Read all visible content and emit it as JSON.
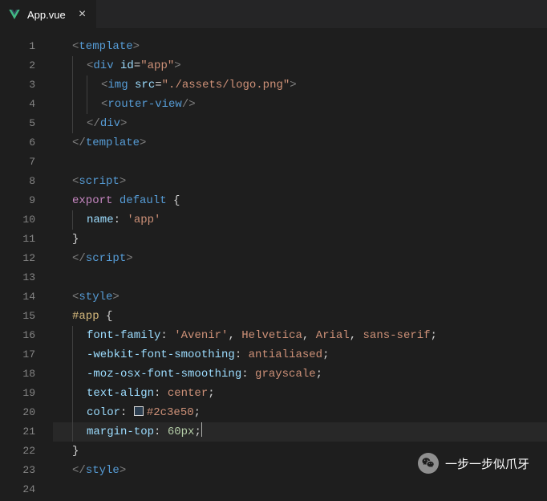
{
  "tab": {
    "filename": "App.vue",
    "close_glyph": "×"
  },
  "gutter": {
    "start": 1,
    "end": 24
  },
  "code": {
    "l1": {
      "p1": "<",
      "tag": "template",
      "p2": ">"
    },
    "l2": {
      "p1": "<",
      "tag": "div",
      "sp": " ",
      "attr": "id",
      "eq": "=",
      "str": "\"app\"",
      "p2": ">"
    },
    "l3": {
      "p1": "<",
      "tag": "img",
      "sp": " ",
      "attr": "src",
      "eq": "=",
      "str": "\"./assets/logo.png\"",
      "p2": ">"
    },
    "l4": {
      "p1": "<",
      "tag": "router-view",
      "p2": "/>"
    },
    "l5": {
      "p1": "</",
      "tag": "div",
      "p2": ">"
    },
    "l6": {
      "p1": "</",
      "tag": "template",
      "p2": ">"
    },
    "l8": {
      "p1": "<",
      "tag": "script",
      "p2": ">"
    },
    "l9": {
      "kw1": "export",
      "sp": " ",
      "kw2": "default",
      "sp2": " ",
      "brace": "{"
    },
    "l10": {
      "prop": "name",
      "colon": ":",
      "sp": " ",
      "str": "'app'"
    },
    "l11": {
      "brace": "}"
    },
    "l12": {
      "p1": "</",
      "tag": "script",
      "p2": ">"
    },
    "l14": {
      "p1": "<",
      "tag": "style",
      "p2": ">"
    },
    "l15": {
      "sel": "#app",
      "sp": " ",
      "brace": "{"
    },
    "l16": {
      "prop": "font-family",
      "colon": ":",
      "sp": " ",
      "v1": "'Avenir'",
      "c1": ",",
      "sp2": " ",
      "v2": "Helvetica",
      "c2": ",",
      "sp3": " ",
      "v3": "Arial",
      "c3": ",",
      "sp4": " ",
      "v4": "sans-serif",
      "semi": ";"
    },
    "l17": {
      "prop": "-webkit-font-smoothing",
      "colon": ":",
      "sp": " ",
      "val": "antialiased",
      "semi": ";"
    },
    "l18": {
      "prop": "-moz-osx-font-smoothing",
      "colon": ":",
      "sp": " ",
      "val": "grayscale",
      "semi": ";"
    },
    "l19": {
      "prop": "text-align",
      "colon": ":",
      "sp": " ",
      "val": "center",
      "semi": ";"
    },
    "l20": {
      "prop": "color",
      "colon": ":",
      "sp": " ",
      "val": "#2c3e50",
      "semi": ";"
    },
    "l21": {
      "prop": "margin-top",
      "colon": ":",
      "sp": " ",
      "val": "60px",
      "semi": ";"
    },
    "l22": {
      "brace": "}"
    },
    "l23": {
      "p1": "</",
      "tag": "style",
      "p2": ">"
    }
  },
  "watermark": {
    "text": "一步一步似爪牙"
  },
  "colors": {
    "swatch": "#2c3e50"
  }
}
